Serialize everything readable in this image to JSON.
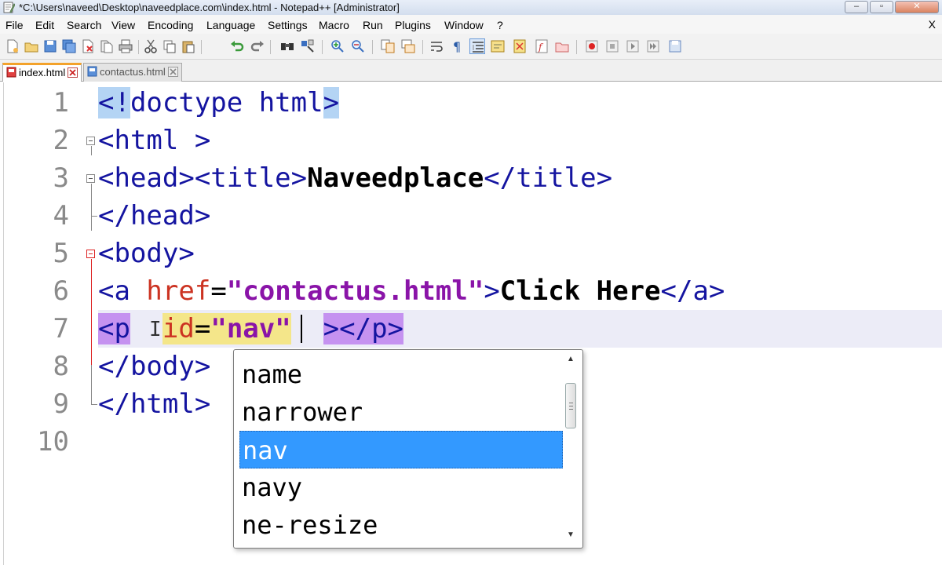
{
  "window": {
    "title": "*C:\\Users\\naveed\\Desktop\\naveedplace.com\\index.html - Notepad++ [Administrator]",
    "minimize": "–",
    "restore": "▫",
    "close": "✕"
  },
  "menu": {
    "file": "File",
    "edit": "Edit",
    "search": "Search",
    "view": "View",
    "encoding": "Encoding",
    "language": "Language",
    "settings": "Settings",
    "macro": "Macro",
    "run": "Run",
    "plugins": "Plugins",
    "window": "Window",
    "help": "?",
    "close": "X"
  },
  "toolbar": {
    "icons": [
      "new-file-icon",
      "open-file-icon",
      "save-icon",
      "save-all-icon",
      "close-icon",
      "close-all-icon",
      "print-icon",
      "cut-icon",
      "copy-icon",
      "paste-icon",
      "undo-icon",
      "redo-icon",
      "find-icon",
      "replace-icon",
      "zoom-in-icon",
      "zoom-out-icon",
      "sync-vertical-icon",
      "sync-horizontal-icon",
      "word-wrap-icon",
      "show-all-chars-icon",
      "indent-guide-icon",
      "user-language-icon",
      "document-map-icon",
      "function-list-icon",
      "folder-workspace-icon",
      "record-macro-icon",
      "stop-record-icon",
      "play-macro-icon",
      "run-macro-multiple-icon",
      "save-macro-icon"
    ]
  },
  "tabs": [
    {
      "label": "index.html",
      "active": true,
      "modified": true
    },
    {
      "label": "contactus.html",
      "active": false,
      "modified": false
    }
  ],
  "editor": {
    "line_numbers": [
      "1",
      "2",
      "3",
      "4",
      "5",
      "6",
      "7",
      "8",
      "9",
      "10"
    ],
    "lines": {
      "l1": {
        "open": "<!",
        "tag": "doctype html",
        "close": ">"
      },
      "l2": {
        "text": "<html >"
      },
      "l3": {
        "open_head": "<head>",
        "open_title": "<title>",
        "title_text": "Naveedplace",
        "close_title": "</title>"
      },
      "l4": {
        "text": "</head>"
      },
      "l5": {
        "text": "<body>"
      },
      "l6": {
        "open": "<a ",
        "attr": "href",
        "eq": "=",
        "value": "\"contactus.html\"",
        "close": ">",
        "text": "Click Here",
        "end": "</a>"
      },
      "l7": {
        "open": "<p",
        "attr": "id",
        "eq": "=",
        "value_open": "\"nav",
        "value_close": "\"",
        "close": "></p>"
      },
      "l8": {
        "text": "</body>"
      },
      "l9": {
        "text": "</html>"
      }
    }
  },
  "autocomplete": {
    "items": [
      "name",
      "narrower",
      "nav",
      "navy",
      "ne-resize"
    ],
    "selected": "nav"
  }
}
